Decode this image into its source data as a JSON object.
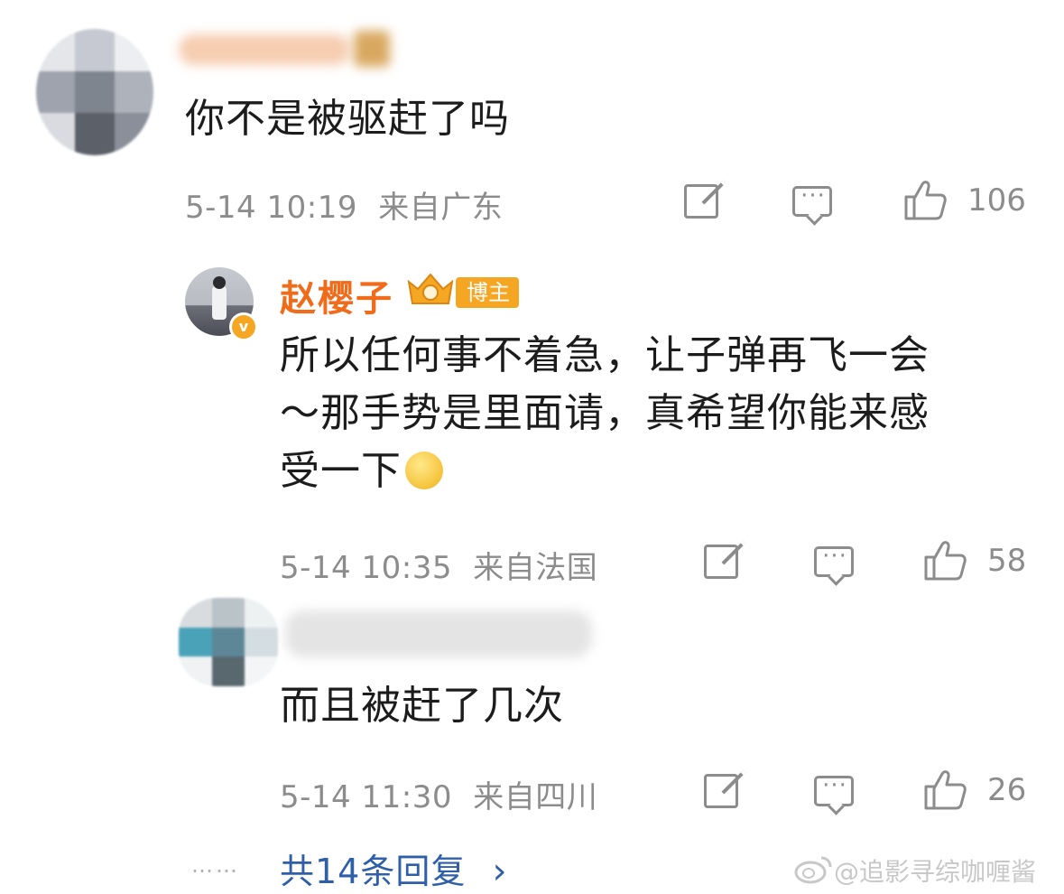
{
  "comments": [
    {
      "author": "",
      "text": "你不是被驱赶了吗",
      "time": "5-14 10:19",
      "location": "来自广东",
      "likes": "106"
    },
    {
      "author": "赵樱子",
      "badge": "博主",
      "verified": "v",
      "text_lines": [
        "所以任何事不着急，让子弹再飞一会",
        "～那手势是里面请，真希望你能来感",
        "受一下"
      ],
      "time": "5-14 10:35",
      "location": "来自法国",
      "likes": "58"
    },
    {
      "author": "",
      "text": "而且被赶了几次",
      "time": "5-14 11:30",
      "location": "来自四川",
      "likes": "26"
    }
  ],
  "footer": {
    "dots": "……",
    "replies_label": "共14条回复",
    "chevron": "›",
    "watermark": "@追影寻综咖喱酱"
  },
  "icons": [
    "share-edit-icon",
    "comment-icon",
    "like-icon",
    "crown-icon",
    "smiley-emoji",
    "verified-badge-icon",
    "weibo-logo-icon"
  ],
  "colors": {
    "accent_orange": "#f06b1a",
    "link_blue": "#2f5fa8",
    "meta_gray": "#8c8c8c"
  }
}
